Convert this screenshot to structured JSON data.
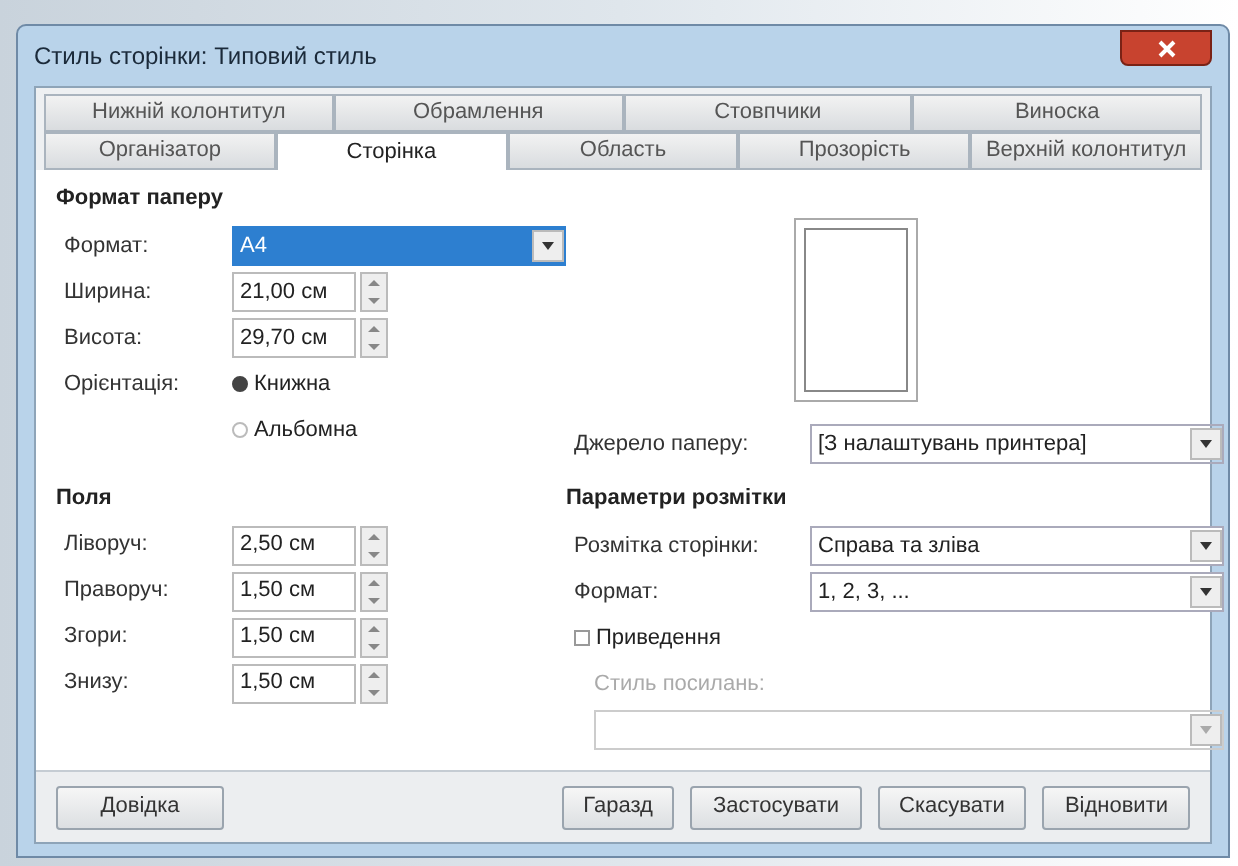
{
  "window": {
    "title": "Стиль сторінки: Типовий стиль"
  },
  "tab_rows": [
    [
      {
        "label": "Нижній колонтитул",
        "selected": false
      },
      {
        "label": "Обрамлення",
        "selected": false
      },
      {
        "label": "Стовпчики",
        "selected": false
      },
      {
        "label": "Виноска",
        "selected": false
      }
    ],
    [
      {
        "label": "Організатор",
        "selected": false
      },
      {
        "label": "Сторінка",
        "selected": true
      },
      {
        "label": "Область",
        "selected": false
      },
      {
        "label": "Прозорість",
        "selected": false
      },
      {
        "label": "Верхній колонтитул",
        "selected": false
      }
    ]
  ],
  "paper_format": {
    "heading": "Формат паперу",
    "rows": [
      {
        "kind": "select",
        "label": "Формат:",
        "value": "A4",
        "focused": true
      },
      {
        "kind": "spin",
        "label": "Ширина:",
        "value": "21,00 см"
      },
      {
        "kind": "spin",
        "label": "Висота:",
        "value": "29,70 см"
      },
      {
        "kind": "radio",
        "label": "Орієнтація:",
        "value": "Книжна",
        "selected": true
      },
      {
        "kind": "radio",
        "value": "Альбомна",
        "selected": false
      }
    ]
  },
  "paper_source": {
    "label": "Джерело паперу:",
    "value": "[З налаштувань принтера]"
  },
  "margins": {
    "heading": "Поля",
    "rows": [
      {
        "kind": "spin",
        "label": "Ліворуч:",
        "value": "2,50 см"
      },
      {
        "kind": "spin",
        "label": "Праворуч:",
        "value": "1,50 см"
      },
      {
        "kind": "spin",
        "label": "Згори:",
        "value": "1,50 см"
      },
      {
        "kind": "spin",
        "label": "Знизу:",
        "value": "1,50 см"
      }
    ]
  },
  "layout": {
    "heading": "Параметри розмітки",
    "rows": [
      {
        "kind": "select",
        "label": "Розмітка сторінки:",
        "value": "Справа та зліва",
        "focused": false
      },
      {
        "kind": "select",
        "label": "Формат:",
        "value": "1, 2, 3, ...",
        "focused": false
      },
      {
        "kind": "checkbox",
        "label": "Приведення",
        "checked": false
      },
      {
        "kind": "caption",
        "label": "Стиль посилань:",
        "disabled": true
      },
      {
        "kind": "wideselect",
        "disabled": true
      }
    ]
  },
  "buttons": [
    {
      "label": "Довідка"
    },
    {
      "label": "Гаразд"
    },
    {
      "label": "Застосувати"
    },
    {
      "label": "Скасувати"
    },
    {
      "label": "Відновити"
    }
  ]
}
